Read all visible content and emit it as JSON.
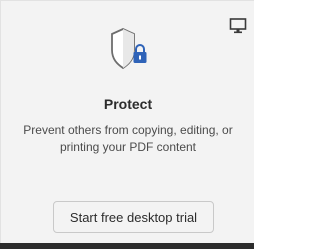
{
  "card": {
    "title": "Protect",
    "description": "Prevent others from copying, editing, or printing your PDF content",
    "button_label": "Start free desktop trial"
  },
  "icons": {
    "corner": "desktop-icon",
    "main": "protect-shield-lock-icon"
  },
  "colors": {
    "accent": "#2c2c2c",
    "card_bg": "#f3f3f3"
  }
}
